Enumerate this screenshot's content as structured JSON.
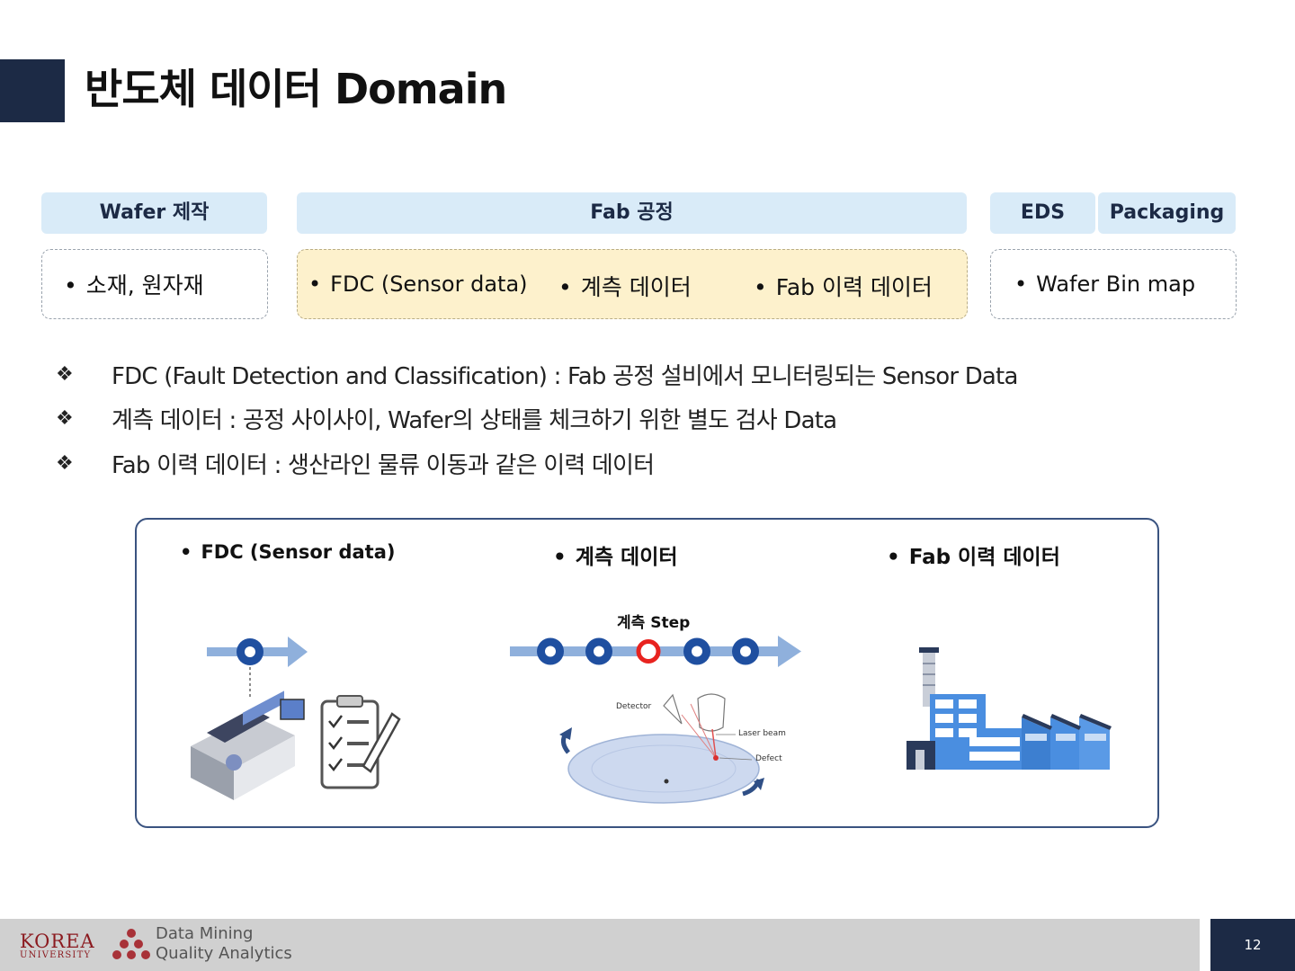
{
  "title": "반도체 데이터 Domain",
  "stages": {
    "wafer": {
      "label": "Wafer 제작",
      "items": [
        "소재, 원자재"
      ]
    },
    "fab": {
      "label": "Fab 공정",
      "items": [
        "FDC (Sensor data)",
        "계측 데이터",
        "Fab 이력 데이터"
      ]
    },
    "eds": {
      "label": "EDS"
    },
    "packaging": {
      "label": "Packaging"
    },
    "eds_pack_items": [
      "Wafer Bin map"
    ]
  },
  "descriptions": [
    "FDC (Fault Detection and Classification) : Fab 공정 설비에서 모니터링되는 Sensor Data",
    "계측 데이터 : 공정 사이사이, Wafer의 상태를 체크하기 위한 별도 검사 Data",
    "Fab 이력 데이터 : 생산라인 물류 이동과 같은 이력 데이터"
  ],
  "diagram": {
    "fdc_label": "FDC (Sensor data)",
    "metrology_label": "계측 데이터",
    "fab_history_label": "Fab 이력 데이터",
    "step_label": "계측 Step",
    "detector_label": "Detector",
    "laser_label": "Laser beam",
    "defect_label": "Defect"
  },
  "footer": {
    "university_line1": "KOREA",
    "university_line2": "UNIVERSITY",
    "lab_line1": "Data Mining",
    "lab_line2": "Quality Analytics",
    "page_number": "12"
  },
  "colors": {
    "navy": "#1c2a45",
    "header_blue": "#d9ebf8",
    "fab_yellow": "#fdf1cc",
    "circle_blue": "#1f4fa0",
    "highlight_red": "#e8231f"
  }
}
